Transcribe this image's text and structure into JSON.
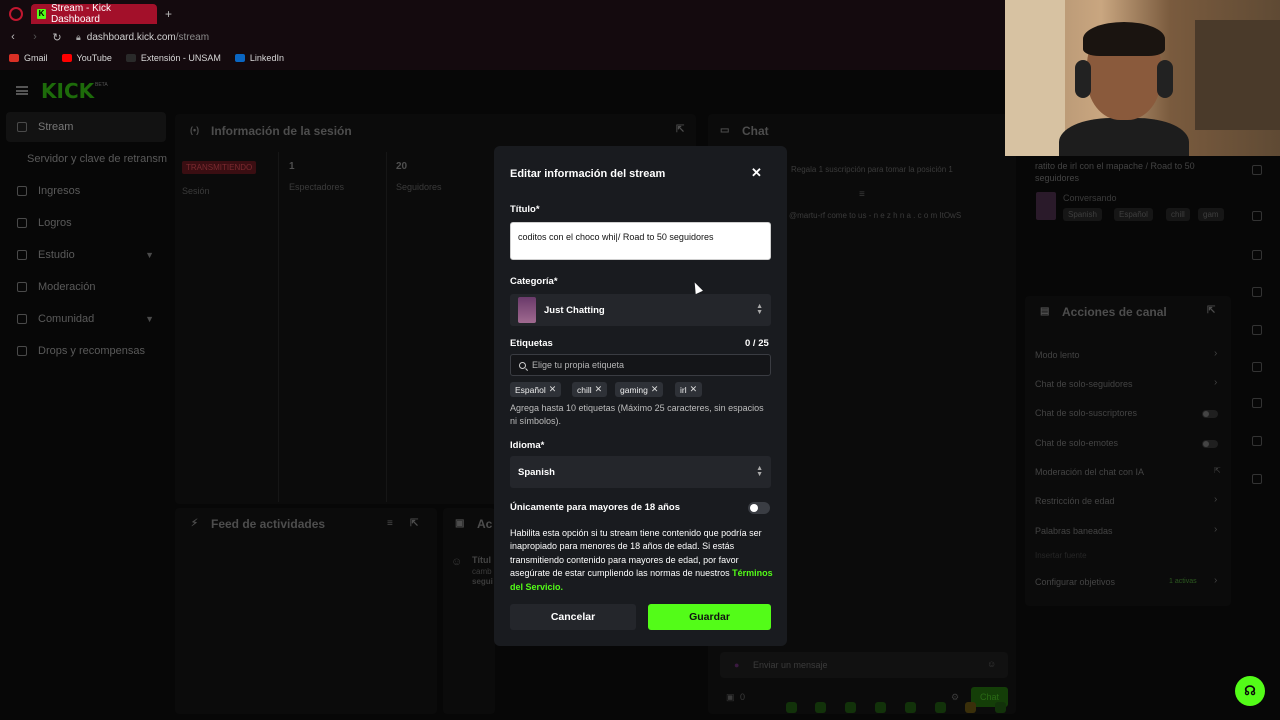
{
  "browser": {
    "tab_title": "Stream - Kick Dashboard",
    "favicon": "K",
    "new_tab": "+",
    "url_host": "dashboard.kick.com",
    "url_path": "/stream",
    "bookmarks": [
      "Gmail",
      "YouTube",
      "Extensión - UNSAM",
      "LinkedIn"
    ]
  },
  "sidebar": {
    "logo": "KICK",
    "logo_badge": "BETA",
    "items": [
      {
        "label": "Stream"
      },
      {
        "label": "Servidor y clave de retransm"
      },
      {
        "label": "Ingresos"
      },
      {
        "label": "Logros"
      },
      {
        "label": "Estudio"
      },
      {
        "label": "Moderación"
      },
      {
        "label": "Comunidad"
      },
      {
        "label": "Drops y recompensas"
      }
    ]
  },
  "session_panel": {
    "title": "Información de la sesión",
    "status": "TRANSMITIENDO",
    "session_label": "Sesión",
    "viewers_value": "1",
    "viewers_label": "Espectadores",
    "followers_value": "20",
    "followers_label": "Seguidores"
  },
  "chat_panel": {
    "title": "Chat",
    "line1": "Regala 1 suscripción para tomar la posición 1",
    "line2": "@martu-rf come to us - n e z h n a . c o m ItOwS",
    "input_placeholder": "Enviar un mensaje",
    "viewer_count": "0",
    "send_label": "Chat"
  },
  "stream_info": {
    "title": "ratito de irl con el mapache / Road to 50 seguidores",
    "category": "Conversando",
    "tags": [
      "Spanish",
      "Español",
      "chill",
      "gam"
    ]
  },
  "activity_panel": {
    "title": "Feed de actividades",
    "side_title": "Ac",
    "side_text_1": "Títul",
    "side_text_2": "camb",
    "side_text_3": "segui"
  },
  "channel_actions": {
    "title": "Acciones de canal",
    "rows": [
      "Modo lento",
      "Chat de solo-seguidores",
      "Chat de solo-suscriptores",
      "Chat de solo-emotes",
      "Moderación del chat con IA",
      "Restricción de edad",
      "Palabras baneadas",
      "Configurar objetivos"
    ],
    "hidden_row": "Insertar fuente",
    "goals_status": "1 activas"
  },
  "modal": {
    "title": "Editar información del stream",
    "close": "✕",
    "title_label": "Título*",
    "title_value": "coditos con el choco whi|/ Road to 50 seguidores",
    "category_label": "Categoría*",
    "category_value": "Just Chatting",
    "tags_label": "Etiquetas",
    "tags_count": "0 / 25",
    "tags_placeholder": "Elige tu propia etiqueta",
    "tags": [
      "Español",
      "chill",
      "gaming",
      "irl"
    ],
    "tags_help": "Agrega hasta 10 etiquetas (Máximo 25 caracteres, sin espacios ni símbolos).",
    "language_label": "Idioma*",
    "language_value": "Spanish",
    "adult_label": "Únicamente para mayores de 18 años",
    "adult_enabled": false,
    "adult_text": "Habilita esta opción si tu stream tiene contenido que podría ser inapropiado para menores de 18 años de edad. Si estás transmitiendo contenido para mayores de edad, por favor asegúrate de estar cumpliendo las normas de nuestros",
    "adult_link": "Términos del Servicio",
    "adult_link_end": ".",
    "cancel_label": "Cancelar",
    "save_label": "Guardar"
  },
  "colors": {
    "accent": "#53fc18",
    "modal_bg": "#191b1f",
    "live_red": "#a3102a"
  }
}
